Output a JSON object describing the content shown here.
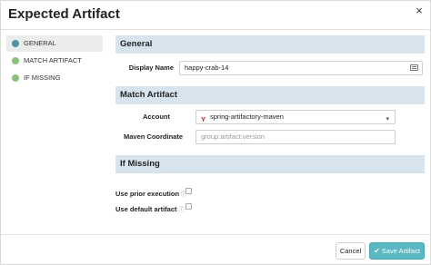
{
  "header": {
    "title": "Expected Artifact",
    "close_glyph": "×"
  },
  "sidebar": {
    "items": [
      {
        "label": "GENERAL",
        "color": "#4b93a5",
        "active": true
      },
      {
        "label": "MATCH ARTIFACT",
        "color": "#8bc17a",
        "active": false
      },
      {
        "label": "IF MISSING",
        "color": "#8bc17a",
        "active": false
      }
    ]
  },
  "general": {
    "heading": "General",
    "display_name_label": "Display Name",
    "display_name_value": "happy-crab-14"
  },
  "match": {
    "heading": "Match Artifact",
    "account_label": "Account",
    "account_value": "spring-artifactory-maven",
    "account_logo_glyph": "ʏ",
    "maven_label": "Maven Coordinate",
    "maven_placeholder": "group:artifact:version"
  },
  "missing": {
    "heading": "If Missing",
    "prior_label": "Use prior execution",
    "default_label": "Use default artifact",
    "help_glyph": "ⓘ"
  },
  "footer": {
    "cancel_label": "Cancel",
    "save_label": "Save Artifact",
    "save_glyph": "✔"
  },
  "colors": {
    "section_bg": "#d7e4ee",
    "primary": "#5bb7c2"
  }
}
